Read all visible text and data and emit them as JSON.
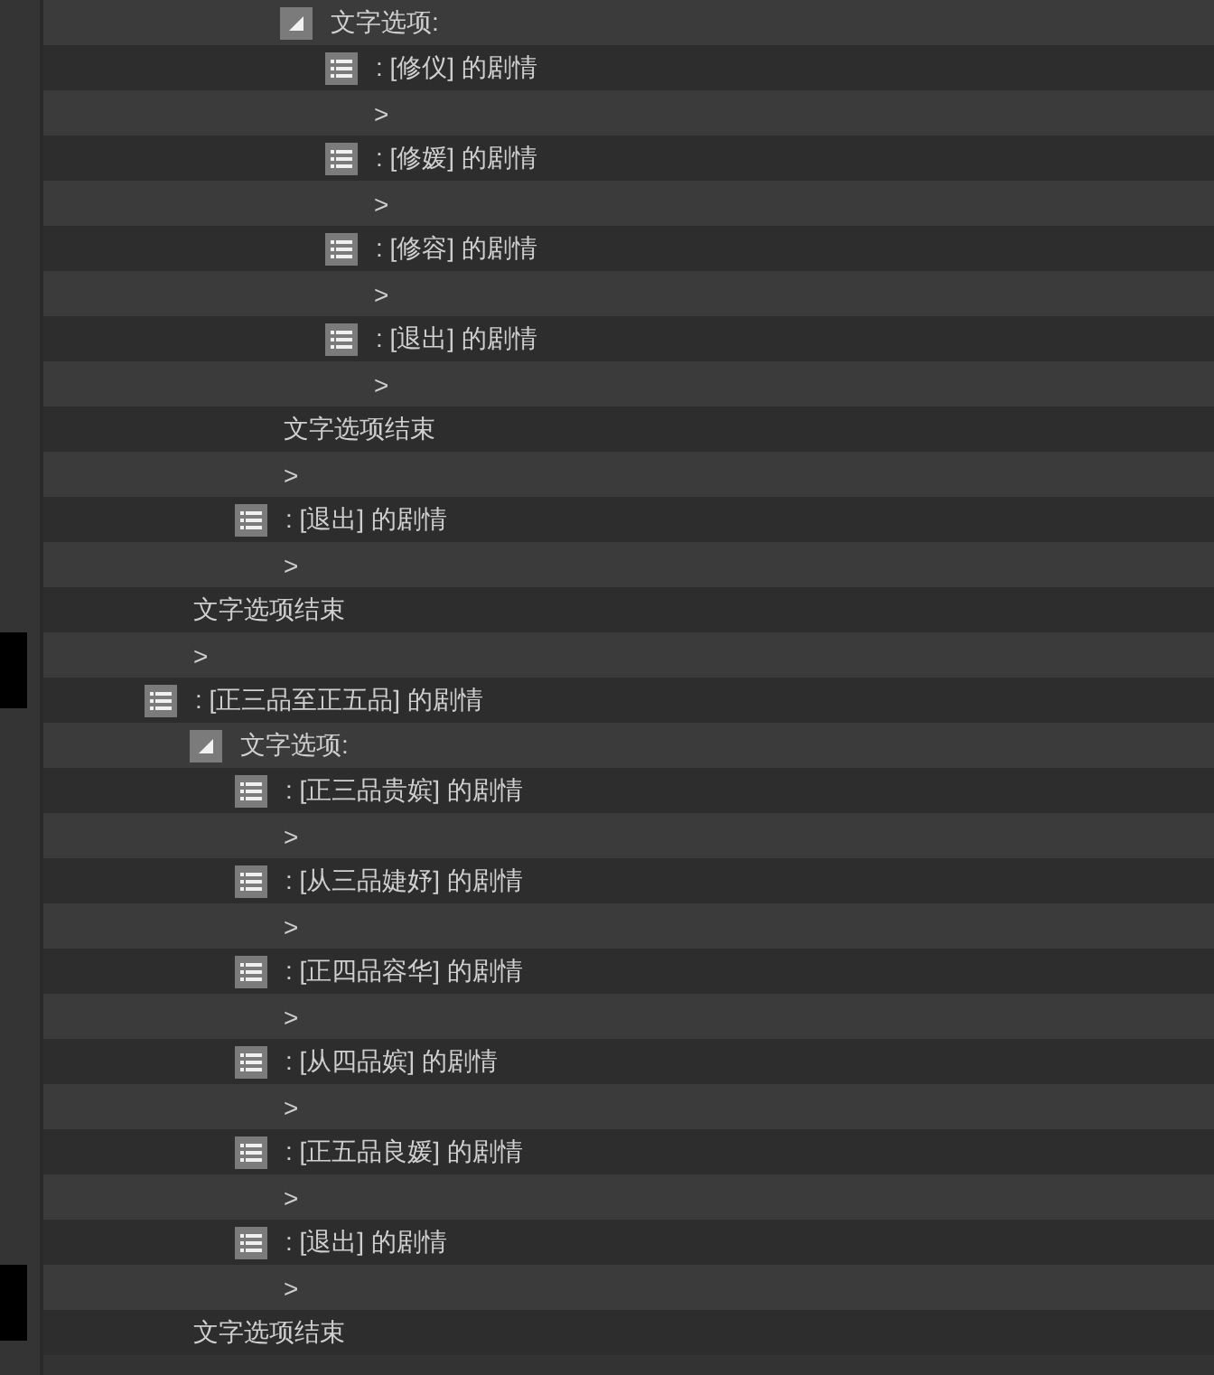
{
  "tree": [
    {
      "kind": "group",
      "children": [
        {
          "kind": "group",
          "children": [
            {
              "kind": "group",
              "children": [
                {
                  "kind": "menu",
                  "label": "文字选项:",
                  "expanded": true,
                  "children": [
                    {
                      "kind": "choice",
                      "label": ": [修仪] 的剧情",
                      "children": [
                        {
                          "kind": "next",
                          "label": ">"
                        }
                      ]
                    },
                    {
                      "kind": "choice",
                      "label": ": [修媛] 的剧情",
                      "children": [
                        {
                          "kind": "next",
                          "label": ">"
                        }
                      ]
                    },
                    {
                      "kind": "choice",
                      "label": ": [修容] 的剧情",
                      "children": [
                        {
                          "kind": "next",
                          "label": ">"
                        }
                      ]
                    },
                    {
                      "kind": "choice",
                      "label": ": [退出] 的剧情",
                      "children": [
                        {
                          "kind": "next",
                          "label": ">"
                        }
                      ]
                    }
                  ]
                },
                {
                  "kind": "end",
                  "label": "文字选项结束"
                },
                {
                  "kind": "next",
                  "label": ">"
                }
              ]
            },
            {
              "kind": "choice",
              "label": ": [退出] 的剧情",
              "children": [
                {
                  "kind": "next",
                  "label": ">"
                }
              ]
            }
          ]
        },
        {
          "kind": "end",
          "label": "文字选项结束"
        },
        {
          "kind": "next",
          "label": ">"
        }
      ]
    },
    {
      "kind": "choice",
      "label": ": [正三品至正五品] 的剧情",
      "children": [
        {
          "kind": "menu",
          "label": "文字选项:",
          "expanded": true,
          "children": [
            {
              "kind": "choice",
              "label": ": [正三品贵嫔] 的剧情",
              "children": [
                {
                  "kind": "next",
                  "label": ">"
                }
              ]
            },
            {
              "kind": "choice",
              "label": ": [从三品婕妤] 的剧情",
              "children": [
                {
                  "kind": "next",
                  "label": ">"
                }
              ]
            },
            {
              "kind": "choice",
              "label": ": [正四品容华] 的剧情",
              "children": [
                {
                  "kind": "next",
                  "label": ">"
                }
              ]
            },
            {
              "kind": "choice",
              "label": ": [从四品嫔] 的剧情",
              "children": [
                {
                  "kind": "next",
                  "label": ">"
                }
              ]
            },
            {
              "kind": "choice",
              "label": ": [正五品良媛] 的剧情",
              "children": [
                {
                  "kind": "next",
                  "label": ">"
                }
              ]
            },
            {
              "kind": "choice",
              "label": ": [退出] 的剧情",
              "children": [
                {
                  "kind": "next",
                  "label": ">"
                }
              ]
            }
          ]
        },
        {
          "kind": "end",
          "label": "文字选项结束"
        }
      ]
    }
  ]
}
